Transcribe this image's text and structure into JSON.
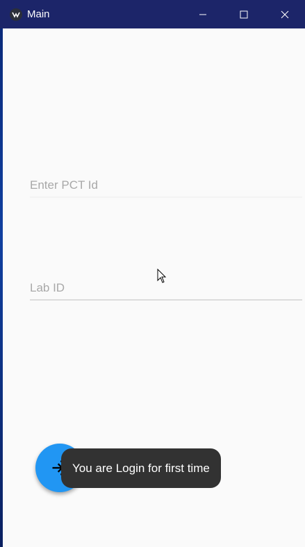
{
  "window": {
    "title": "Main",
    "title_bar_color": "#1c2569",
    "controls": {
      "minimize_icon": "minimize-icon",
      "maximize_icon": "maximize-icon",
      "close_icon": "close-icon"
    }
  },
  "form": {
    "pct_id": {
      "placeholder": "Enter PCT Id",
      "value": ""
    },
    "lab_id": {
      "placeholder": "Lab ID",
      "value": ""
    }
  },
  "fab": {
    "icon": "login-icon",
    "color": "#2196f3"
  },
  "toast": {
    "message": "You are Login for first time"
  }
}
